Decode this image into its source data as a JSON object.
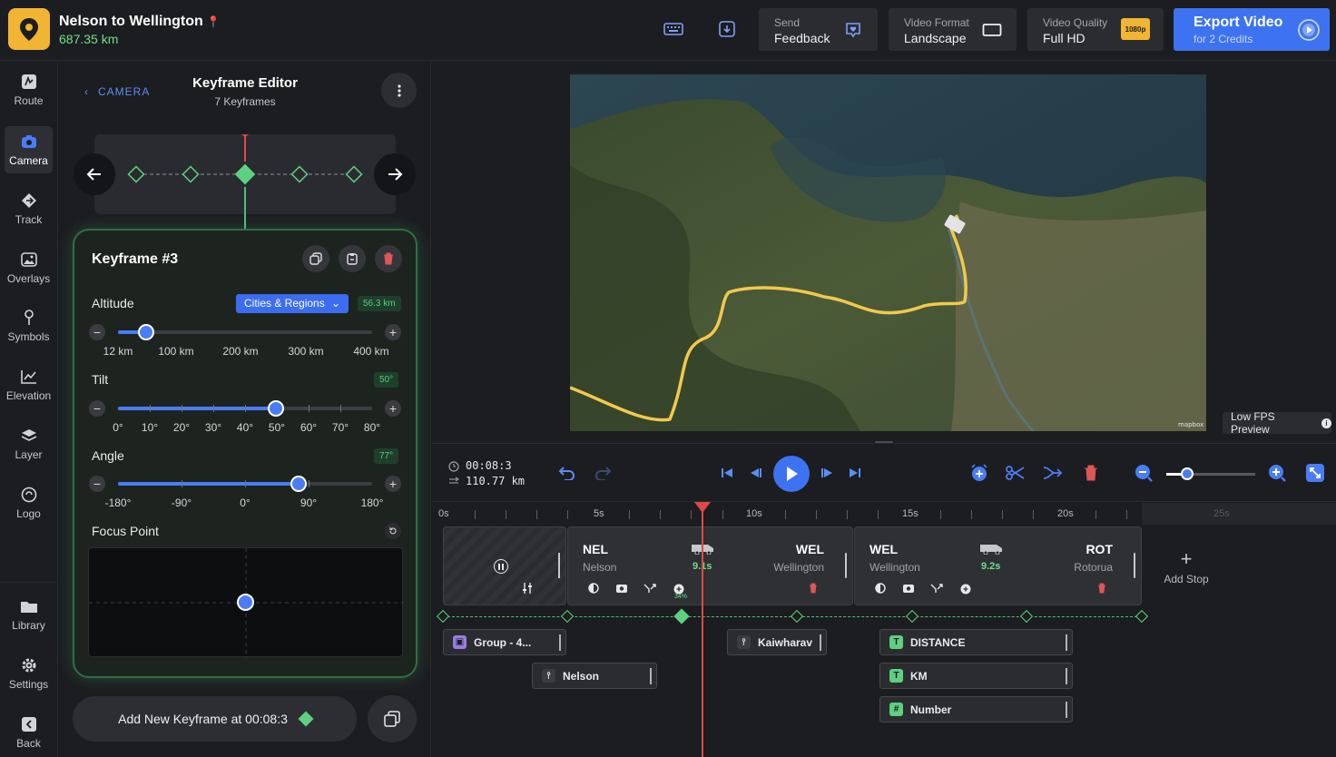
{
  "project": {
    "title": "Nelson to Wellington",
    "distance": "687.35 km"
  },
  "header": {
    "send": {
      "small": "Send",
      "big": "Feedback"
    },
    "format": {
      "small": "Video Format",
      "big": "Landscape"
    },
    "quality": {
      "small": "Video Quality",
      "big": "Full HD",
      "badge": "1080p"
    },
    "export": {
      "big": "Export Video",
      "small": "for 2 Credits"
    }
  },
  "sidebar": [
    {
      "label": "Route",
      "icon": "route-icon"
    },
    {
      "label": "Camera",
      "icon": "camera-icon"
    },
    {
      "label": "Track",
      "icon": "track-icon"
    },
    {
      "label": "Overlays",
      "icon": "overlays-icon"
    },
    {
      "label": "Symbols",
      "icon": "symbols-icon"
    },
    {
      "label": "Elevation",
      "icon": "elevation-icon"
    },
    {
      "label": "Layer",
      "icon": "layer-icon"
    },
    {
      "label": "Logo",
      "icon": "logo-icon"
    },
    {
      "label": "Library",
      "icon": "library-icon"
    },
    {
      "label": "Settings",
      "icon": "settings-icon"
    },
    {
      "label": "Back",
      "icon": "back-icon"
    }
  ],
  "panel": {
    "breadcrumb": "CAMERA",
    "title": "Keyframe Editor",
    "subtitle": "7 Keyframes",
    "keyframe": {
      "title": "Keyframe #3",
      "altitude": {
        "label": "Altitude",
        "preset": "Cities & Regions",
        "value": "56.3 km",
        "ticks": [
          "12 km",
          "100 km",
          "200 km",
          "300 km",
          "400 km"
        ]
      },
      "tilt": {
        "label": "Tilt",
        "value": "50°",
        "ticks": [
          "0°",
          "10°",
          "20°",
          "30°",
          "40°",
          "50°",
          "60°",
          "70°",
          "80°"
        ]
      },
      "angle": {
        "label": "Angle",
        "value": "77°",
        "ticks": [
          "-180°",
          "-90°",
          "0°",
          "90°",
          "180°"
        ]
      },
      "focus": {
        "label": "Focus Point"
      }
    },
    "add_keyframe": "Add New Keyframe at 00:08:3"
  },
  "preview": {
    "fps_label": "Low FPS Preview",
    "attribution": "mapbox"
  },
  "transport": {
    "time": "00:08:3",
    "distance": "110.77 km"
  },
  "timeline": {
    "ruler": [
      "0s",
      "5s",
      "10s",
      "15s",
      "20s",
      "25s"
    ],
    "segments": [
      {
        "from_code": "NEL",
        "from_city": "Nelson",
        "to_code": "WEL",
        "to_city": "Wellington",
        "duration": "9.1s",
        "progress": "34%"
      },
      {
        "from_code": "WEL",
        "from_city": "Wellington",
        "to_code": "ROT",
        "to_city": "Rotorua",
        "duration": "9.2s"
      }
    ],
    "add_stop": "Add Stop",
    "overlays": [
      {
        "label": "Group - 4...",
        "type": "group"
      },
      {
        "label": "Nelson",
        "type": "pin"
      },
      {
        "label": "Kaiwharav",
        "type": "pin"
      },
      {
        "label": "DISTANCE",
        "type": "text"
      },
      {
        "label": "KM",
        "type": "text"
      },
      {
        "label": "Number",
        "type": "number"
      }
    ]
  },
  "colors": {
    "accent": "#3d73f0",
    "keyframe": "#5ed07f",
    "playhead": "#e04848",
    "route": "#f2c94c"
  }
}
